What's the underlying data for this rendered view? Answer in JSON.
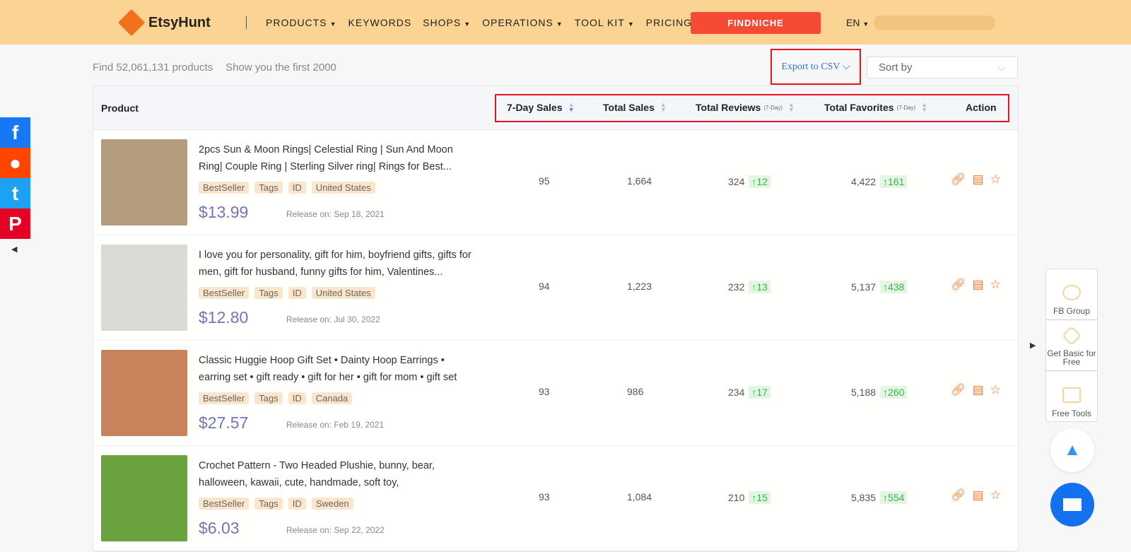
{
  "header": {
    "logo": "EtsyHunt",
    "nav": [
      "PRODUCTS",
      "KEYWORDS",
      "SHOPS",
      "OPERATIONS",
      "TOOL KIT",
      "PRICING"
    ],
    "nav_dropdown": [
      true,
      false,
      true,
      true,
      true,
      false
    ],
    "findniche": "FINDNICHE",
    "lang": "EN"
  },
  "summary": {
    "found": "Find 52,061,131 products",
    "shown": "Show you the first 2000"
  },
  "export_label": "Export to CSV",
  "sort_label": "Sort by",
  "columns": {
    "product": "Product",
    "sales7": "7-Day Sales",
    "total_sales": "Total Sales",
    "reviews": "Total Reviews",
    "reviews_sub": "(7-Day)",
    "favorites": "Total Favorites",
    "favorites_sub": "(7-Day)",
    "action": "Action"
  },
  "rows": [
    {
      "title": "2pcs Sun & Moon Rings| Celestial Ring | Sun And Moon Ring| Couple Ring | Sterling Silver ring| Rings for Best...",
      "tags": [
        "BestSeller",
        "Tags",
        "ID",
        "United States"
      ],
      "price": "$13.99",
      "release": "Release on: Sep 18, 2021",
      "sales7": "95",
      "total_sales": "1,664",
      "reviews": "324",
      "reviews_inc": "12",
      "favorites": "4,422",
      "favorites_inc": "161",
      "img": "#b49d7c"
    },
    {
      "title": "I love you for personality, gift for him, boyfriend gifts, gifts for men, gift for husband, funny gifts for him, Valentines...",
      "tags": [
        "BestSeller",
        "Tags",
        "ID",
        "United States"
      ],
      "price": "$12.80",
      "release": "Release on: Jul 30, 2022",
      "sales7": "94",
      "total_sales": "1,223",
      "reviews": "232",
      "reviews_inc": "13",
      "favorites": "5,137",
      "favorites_inc": "438",
      "img": "#dcdad6"
    },
    {
      "title": "Classic Huggie Hoop Gift Set • Dainty Hoop Earrings • earring set • gift ready • gift for her • gift for mom • gift set",
      "tags": [
        "BestSeller",
        "Tags",
        "ID",
        "Canada"
      ],
      "price": "$27.57",
      "release": "Release on: Feb 19, 2021",
      "sales7": "93",
      "total_sales": "986",
      "reviews": "234",
      "reviews_inc": "17",
      "favorites": "5,188",
      "favorites_inc": "260",
      "img": "#c9835c"
    },
    {
      "title": "Crochet Pattern - Two Headed Plushie, bunny, bear, halloween, kawaii, cute, handmade, soft toy,",
      "tags": [
        "BestSeller",
        "Tags",
        "ID",
        "Sweden"
      ],
      "price": "$6.03",
      "release": "Release on: Sep 22, 2022",
      "sales7": "93",
      "total_sales": "1,084",
      "reviews": "210",
      "reviews_inc": "15",
      "favorites": "5,835",
      "favorites_inc": "554",
      "img": "#6aa33e"
    }
  ],
  "side": {
    "fb_group": "FB Group",
    "get_basic": "Get Basic for Free",
    "free_tools": "Free Tools"
  },
  "share": [
    {
      "name": "facebook",
      "glyph": "f",
      "color": "#1877f2"
    },
    {
      "name": "reddit",
      "glyph": "●",
      "color": "#ff4500"
    },
    {
      "name": "twitter",
      "glyph": "t",
      "color": "#1da1f2"
    },
    {
      "name": "pinterest",
      "glyph": "P",
      "color": "#e60023"
    }
  ]
}
